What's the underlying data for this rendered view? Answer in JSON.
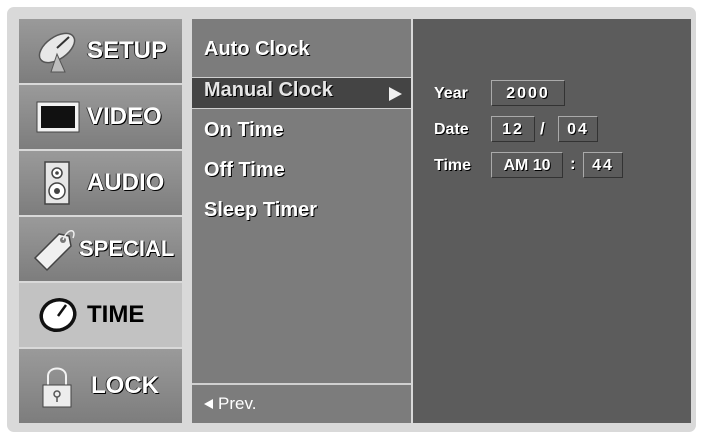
{
  "categories": [
    {
      "label": "SETUP",
      "icon": "satellite-dish-icon",
      "selected": false
    },
    {
      "label": "VIDEO",
      "icon": "monitor-icon",
      "selected": false
    },
    {
      "label": "AUDIO",
      "icon": "speaker-icon",
      "selected": false
    },
    {
      "label": "SPECIAL",
      "icon": "tag-icon",
      "selected": false
    },
    {
      "label": "TIME",
      "icon": "clock-icon",
      "selected": true
    },
    {
      "label": "LOCK",
      "icon": "padlock-icon",
      "selected": false
    }
  ],
  "menu": {
    "items": [
      "Auto Clock",
      "Manual Clock",
      "On Time",
      "Off Time",
      "Sleep Timer"
    ],
    "selected_index": 1,
    "prev_label": "Prev."
  },
  "manual_clock": {
    "year_label": "Year",
    "year_value": "2000",
    "date_label": "Date",
    "month_value": "12",
    "date_separator": "/",
    "day_value": "04",
    "time_label": "Time",
    "hour_value": "AM 10",
    "time_separator": ":",
    "minute_value": "44"
  },
  "colors": {
    "frame": "#d9d9d9",
    "selected_category": "#c2c2c2",
    "menu_highlight": "#444444",
    "panel": "#5c5c5c"
  }
}
